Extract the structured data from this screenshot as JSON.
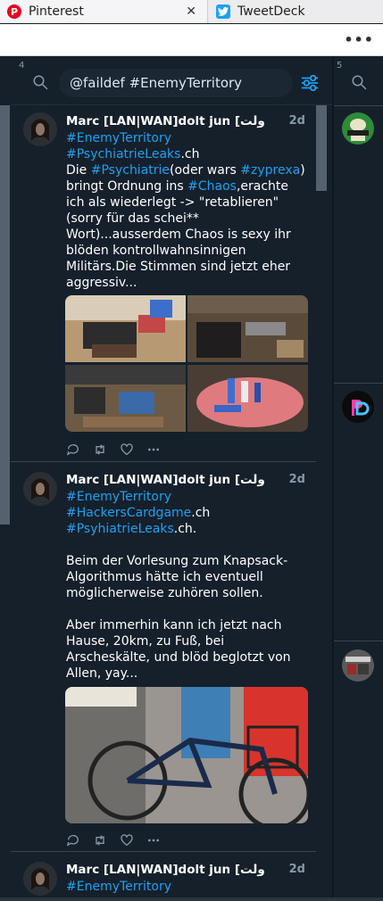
{
  "browser": {
    "tabs": [
      {
        "title": "Pinterest",
        "icon": "pinterest-icon",
        "color": "#e60023"
      },
      {
        "title": "TweetDeck",
        "icon": "tweetdeck-icon",
        "color": "#1da1f2"
      }
    ],
    "close_glyph": "✕",
    "menu_glyph": "•••"
  },
  "columns": [
    {
      "number": "4",
      "search_query": "@faildef #EnemyTerritory",
      "tweets": [
        {
          "author": "Marc [LAN|WAN]dolt jun [ولت",
          "time": "2d",
          "lines": [
            [
              {
                "t": "#EnemyTerritory",
                "h": true
              }
            ],
            [
              {
                "t": "#PsychiatrieLeaks",
                "h": true
              },
              {
                "t": ".ch",
                "h": false
              }
            ],
            [
              {
                "t": "Die ",
                "h": false
              },
              {
                "t": "#Psychiatrie",
                "h": true
              },
              {
                "t": "(oder wars ",
                "h": false
              },
              {
                "t": "#zyprexa",
                "h": true
              },
              {
                "t": ")",
                "h": false
              }
            ],
            [
              {
                "t": "bringt Ordnung ins ",
                "h": false
              },
              {
                "t": "#Chaos",
                "h": true
              },
              {
                "t": ",erachte",
                "h": false
              }
            ],
            [
              {
                "t": "ich als wiederlegt -> \"retablieren\"",
                "h": false
              }
            ],
            [
              {
                "t": "(sorry für das schei**",
                "h": false
              }
            ],
            [
              {
                "t": "Wort)...ausserdem Chaos is sexy ihr",
                "h": false
              }
            ],
            [
              {
                "t": "blöden kontrollwahnsinnigen",
                "h": false
              }
            ],
            [
              {
                "t": "Militärs.Die Stimmen sind jetzt eher",
                "h": false
              }
            ],
            [
              {
                "t": "aggressiv...",
                "h": false
              }
            ]
          ],
          "media_count": 4
        },
        {
          "author": "Marc [LAN|WAN]dolt jun [ولت",
          "time": "2d",
          "lines": [
            [
              {
                "t": "#EnemyTerritory",
                "h": true
              }
            ],
            [
              {
                "t": "#HackersCardgame",
                "h": true
              },
              {
                "t": ".ch",
                "h": false
              }
            ],
            [
              {
                "t": "#PsyhiatrieLeaks",
                "h": true
              },
              {
                "t": ".ch.",
                "h": false
              }
            ],
            [
              {
                "t": " ",
                "h": false
              }
            ],
            [
              {
                "t": "Beim der Vorlesung zum Knapsack-",
                "h": false
              }
            ],
            [
              {
                "t": "Algorithmus hätte ich eventuell",
                "h": false
              }
            ],
            [
              {
                "t": "möglicherweise zuhören sollen.",
                "h": false
              }
            ],
            [
              {
                "t": " ",
                "h": false
              }
            ],
            [
              {
                "t": "Aber immerhin kann ich jetzt nach",
                "h": false
              }
            ],
            [
              {
                "t": "Hause, 20km, zu Fuß,  bei",
                "h": false
              }
            ],
            [
              {
                "t": "Arscheskälte, und blöd beglotzt von",
                "h": false
              }
            ],
            [
              {
                "t": "Allen, yay...",
                "h": false
              }
            ]
          ],
          "media_count": 1
        },
        {
          "author": "Marc [LAN|WAN]dolt jun [ولت",
          "time": "2d",
          "lines": [
            [
              {
                "t": "#EnemyTerritory",
                "h": true
              }
            ]
          ],
          "media_count": 0
        }
      ]
    },
    {
      "number": "5"
    }
  ],
  "theme": {
    "background": "#15202b",
    "link": "#1da1f2",
    "muted": "#8899a6",
    "divider": "#38444d"
  }
}
